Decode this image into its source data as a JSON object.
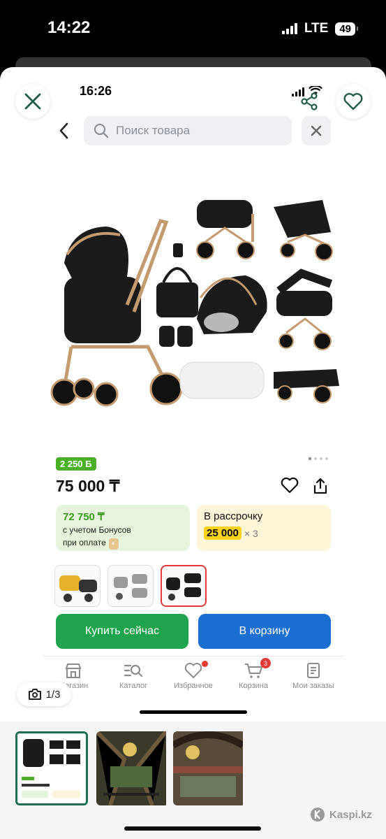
{
  "outer_status": {
    "time": "14:22",
    "network": "LTE",
    "battery": "49"
  },
  "inner_status": {
    "time": "16:26"
  },
  "search": {
    "placeholder": "Поиск товара"
  },
  "product": {
    "bonus_badge": "2 250 Б",
    "price": "75 000 ₸",
    "bonus_card": {
      "amount": "72 750 ₸",
      "line1": "с учетом Бонусов",
      "line2": "при оплате"
    },
    "installment": {
      "label": "В рассрочку",
      "amount": "25 000",
      "times": "× 3"
    }
  },
  "buttons": {
    "buy": "Купить сейчас",
    "cart": "В корзину"
  },
  "tabs": [
    {
      "label": "Магазин",
      "icon": "store-icon"
    },
    {
      "label": "Каталог",
      "icon": "catalog-icon"
    },
    {
      "label": "Избранное",
      "icon": "heart-icon"
    },
    {
      "label": "Корзина",
      "icon": "cart-icon",
      "count": "3"
    },
    {
      "label": "Мои заказы",
      "icon": "orders-icon"
    }
  ],
  "counter": "1/3",
  "brand": "Kaspi.kz"
}
